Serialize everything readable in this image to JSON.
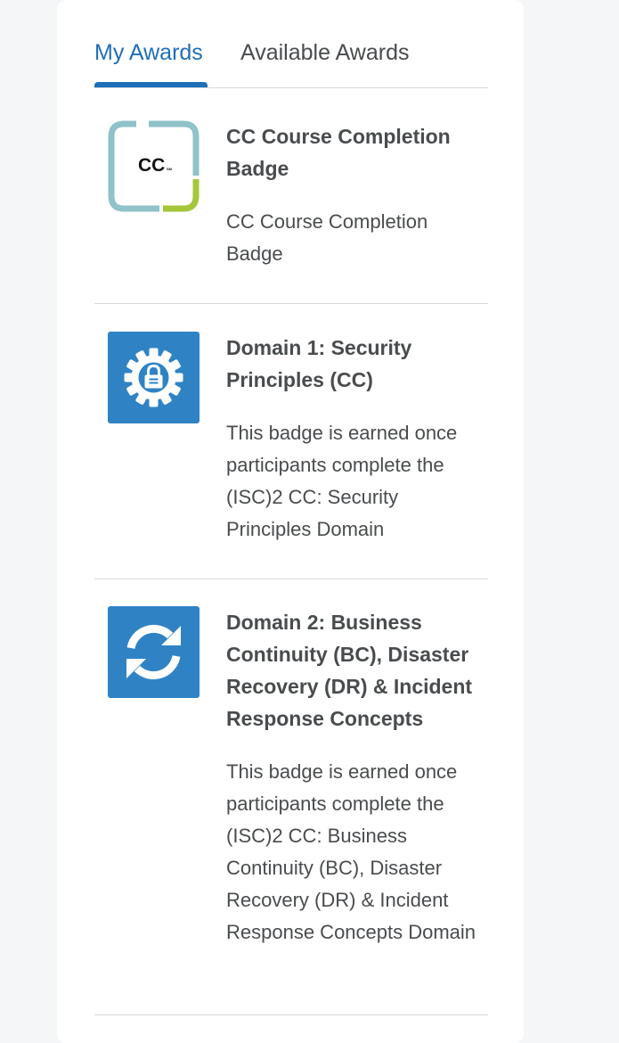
{
  "tabs": {
    "my_awards": "My Awards",
    "available_awards": "Available Awards"
  },
  "awards": [
    {
      "icon": "cc-logo-icon",
      "logo_text": "CC",
      "logo_sup": "SM",
      "title": "CC Course Completion Badge",
      "description": "CC Course Completion Badge"
    },
    {
      "icon": "gear-lock-icon",
      "title": "Domain 1: Security Principles (CC)",
      "description": "This badge is earned once participants complete the (ISC)2 CC: Security Principles Domain"
    },
    {
      "icon": "refresh-icon",
      "title": "Domain 2: Business Continuity (BC), Disaster Recovery (DR) & Incident Response Concepts",
      "description": "This badge is earned once participants complete the (ISC)2 CC: Business Continuity (BC), Disaster Recovery (DR) & Incident Response Concepts Domain"
    }
  ],
  "colors": {
    "accent": "#1e6fb8",
    "tile": "#2f83c5",
    "logo_teal": "#8fc2c9",
    "logo_green": "#a6c63a",
    "text": "#494c4e",
    "divider": "#d8dadd",
    "background": "#f5f6f8"
  }
}
